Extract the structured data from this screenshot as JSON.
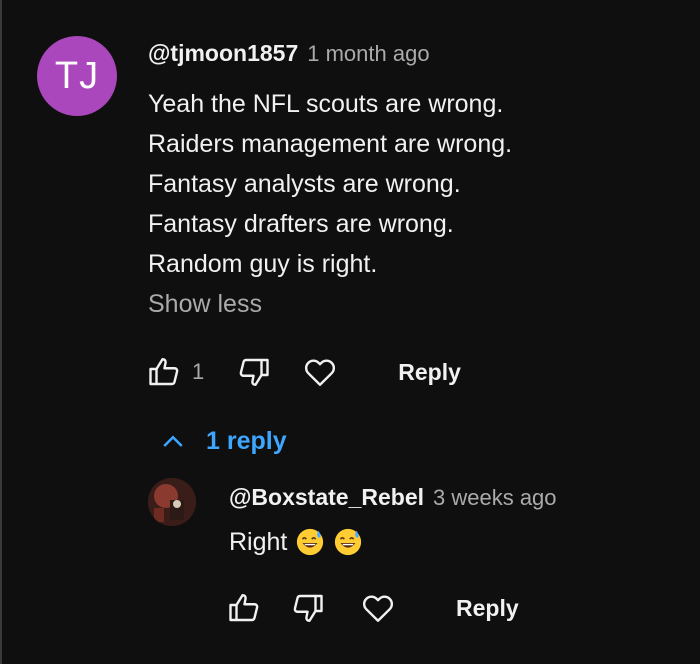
{
  "comment": {
    "avatar_initials": "TJ",
    "handle": "@tjmoon1857",
    "time": "1 month ago",
    "lines": [
      "Yeah the NFL scouts are wrong.",
      "Raiders management are wrong.",
      "Fantasy analysts are wrong.",
      "Fantasy drafters are wrong.",
      "Random guy is right."
    ],
    "show_less": "Show less",
    "like_count": "1",
    "reply_label": "Reply"
  },
  "replies_toggle": {
    "label": "1 reply",
    "icon": "chevron-up-icon"
  },
  "reply": {
    "handle": "@Boxstate_Rebel",
    "time": "3 weeks ago",
    "text": "Right",
    "emojis": [
      "grinning-face-with-sweat",
      "grinning-face-with-sweat"
    ],
    "reply_label": "Reply"
  },
  "colors": {
    "background": "#0f0f0f",
    "avatar": "#ab47bc",
    "link": "#3ea6ff",
    "secondary_text": "#aaaaaa"
  }
}
